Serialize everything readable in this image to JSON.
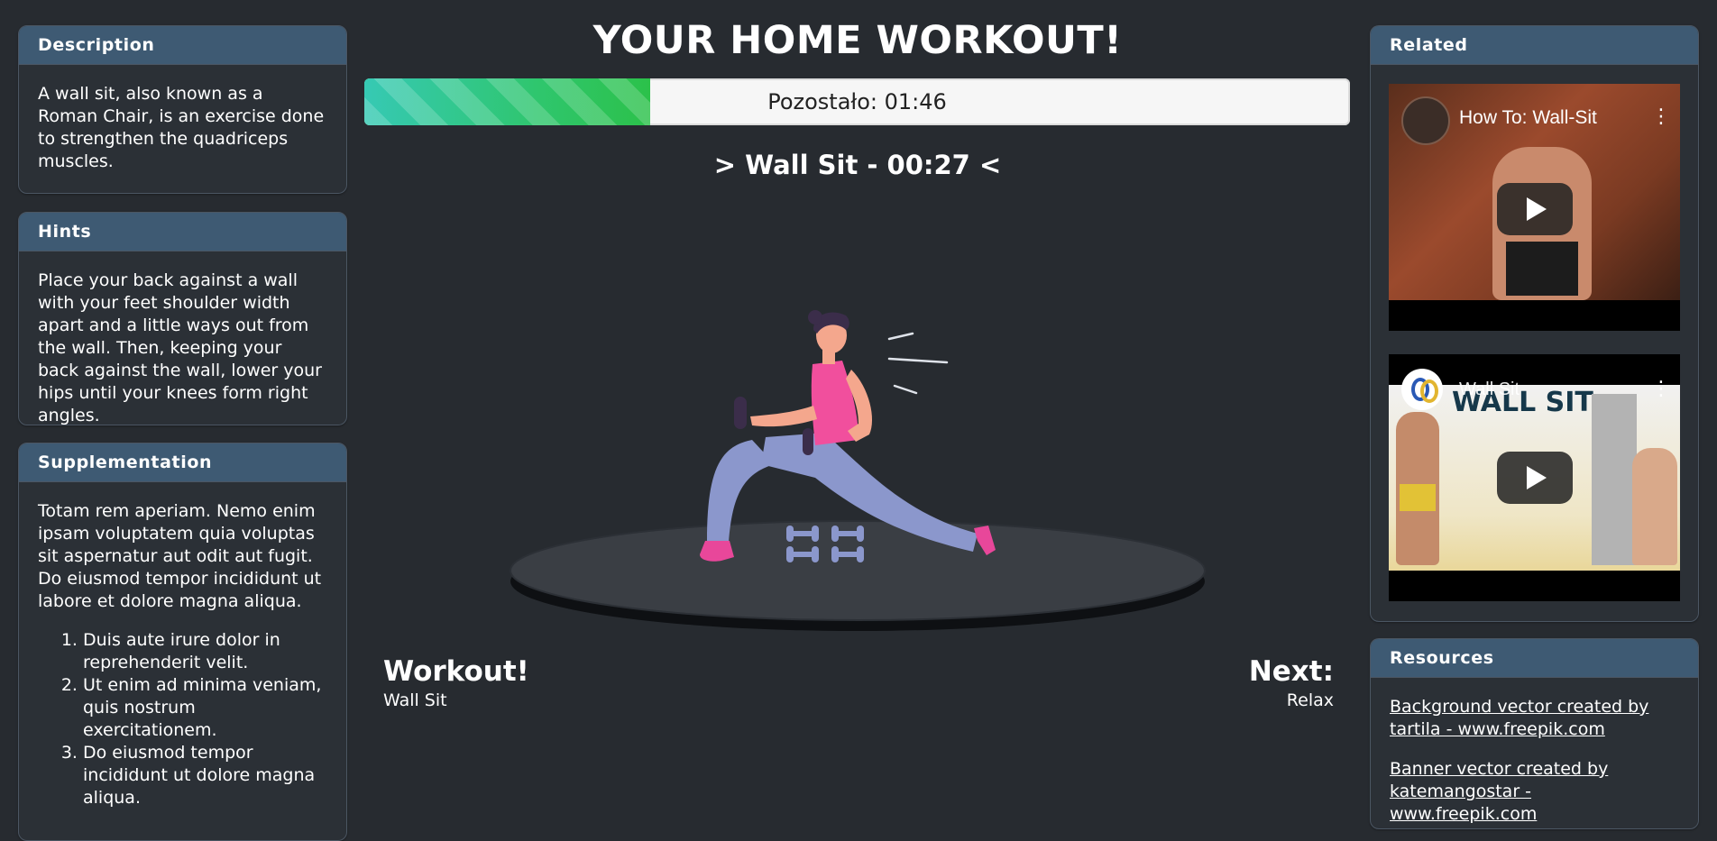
{
  "left": {
    "description": {
      "title": "Description",
      "text": "A wall sit, also known as a Roman Chair, is an exercise done to strengthen the quadriceps muscles."
    },
    "hints": {
      "title": "Hints",
      "text": "Place your back against a wall with your feet shoulder width apart and a little ways out from the wall. Then, keeping your back against the wall, lower your hips until your knees form right angles."
    },
    "supplementation": {
      "title": "Supplementation",
      "text": "Totam rem aperiam. Nemo enim ipsam voluptatem quia voluptas sit aspernatur aut odit aut fugit. Do eiusmod tempor incididunt ut labore et dolore magna aliqua.",
      "list": [
        "Duis aute irure dolor in reprehenderit velit.",
        "Ut enim ad minima veniam, quis nostrum exercitationem.",
        "Do eiusmod tempor incididunt ut dolore magna aliqua."
      ]
    }
  },
  "main": {
    "title": "YOUR HOME WORKOUT!",
    "progress": {
      "fraction": 0.29,
      "text": "Pozostało: 01:46"
    },
    "current": "> Wall Sit - 00:27 <",
    "footer": {
      "left_heading": "Workout!",
      "left_sub": "Wall Sit",
      "right_heading": "Next:",
      "right_sub": "Relax"
    }
  },
  "right": {
    "related": {
      "title": "Related",
      "videos": [
        {
          "title": "How To: Wall-Sit",
          "icon": "play-icon"
        },
        {
          "title": "Wall Sit",
          "overlay_text": "WALL SIT",
          "icon": "play-icon"
        }
      ]
    },
    "resources": {
      "title": "Resources",
      "links": [
        "Background vector created by tartila - www.freepik.com",
        "Banner vector created by katemangostar - www.freepik.com"
      ]
    }
  },
  "colors": {
    "background": "#272b30",
    "card": "#2b3036",
    "card_header": "#3e5a73",
    "progress_fill": "#2fc46d",
    "figure_top": "#f14f9d",
    "figure_pants": "#8b97cc"
  }
}
